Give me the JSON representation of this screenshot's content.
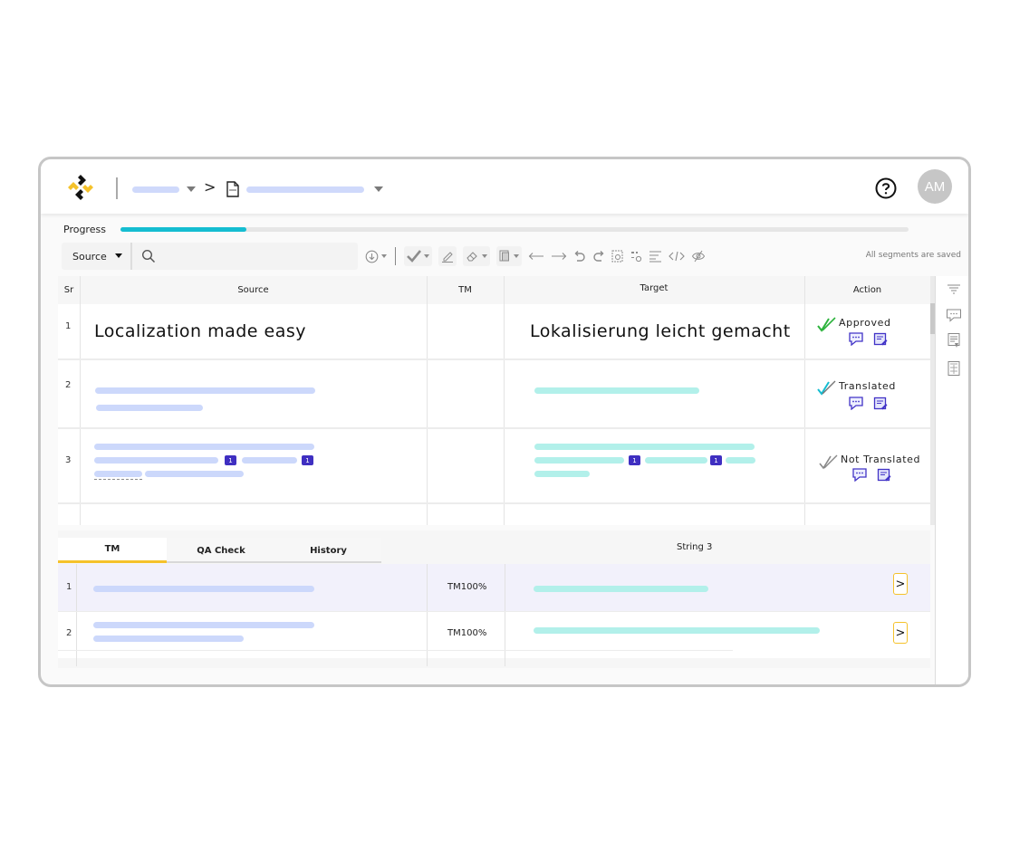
{
  "header": {
    "breadcrumb_separator": ">",
    "help_icon": "help-circle-icon",
    "avatar_initials": "AM"
  },
  "progress": {
    "label": "Progress",
    "percent": 16
  },
  "search": {
    "scope_selected": "Source",
    "placeholder": "",
    "value": ""
  },
  "toolbar": {
    "icons": [
      "download-icon",
      "confirm-check-icon",
      "edit-pencil-icon",
      "eraser-icon",
      "copy-icon",
      "arrow-left-icon",
      "arrow-right-icon",
      "undo-icon",
      "redo-icon",
      "find-replace-icon",
      "special-chars-icon",
      "wrap-text-icon",
      "code-tags-icon",
      "hide-icon"
    ],
    "save_status": "All segments are saved"
  },
  "grid": {
    "columns": [
      "Sr",
      "Source",
      "TM",
      "Target",
      "Action"
    ],
    "rows": [
      {
        "sr": "1",
        "source": "Localization made easy",
        "tm": "",
        "target": "Lokalisierung leicht gemacht",
        "status": "Approved",
        "status_color": "#2db33d"
      },
      {
        "sr": "2",
        "source": "",
        "tm": "",
        "target": "",
        "status": "Translated",
        "status_color": "#15bdd1"
      },
      {
        "sr": "3",
        "source": "",
        "tm": "",
        "target": "",
        "status": "Not Translated",
        "status_color": "#888888",
        "tags": [
          "1",
          "1"
        ]
      }
    ]
  },
  "bottom_panel": {
    "tabs": [
      {
        "label": "TM",
        "active": true
      },
      {
        "label": "QA Check",
        "active": false
      },
      {
        "label": "History",
        "active": false
      }
    ],
    "string_label": "String 3",
    "matches": [
      {
        "sr": "1",
        "match": "TM100%"
      },
      {
        "sr": "2",
        "match": "TM100%"
      }
    ],
    "apply_glyph": ">"
  },
  "right_sidebar": {
    "icons": [
      "filter-icon",
      "comments-icon",
      "notes-icon",
      "glossary-icon"
    ]
  },
  "colors": {
    "accent_progress": "#15bdd1",
    "tag": "#3f2fc1",
    "tab_active": "#f5c22b",
    "source_placeholder": "#ccd8fb",
    "target_placeholder": "#b2f0ea"
  }
}
